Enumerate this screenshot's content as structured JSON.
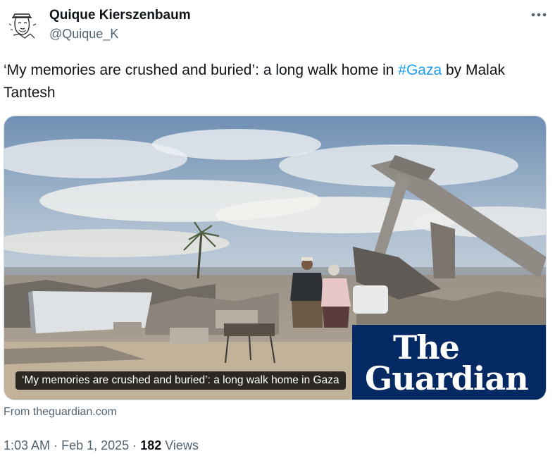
{
  "author": {
    "name": "Quique Kierszenbaum",
    "handle": "@Quique_K"
  },
  "tweet": {
    "text_before": "‘My memories are crushed and buried’: a long walk home in ",
    "hashtag": "#Gaza",
    "text_after": " by Malak Tantesh"
  },
  "card": {
    "caption": "‘My memories are crushed and buried’: a long walk home in Gaza",
    "logo_line1": "The",
    "logo_line2": "Guardian",
    "source": "From theguardian.com"
  },
  "meta": {
    "time": "1:03 AM",
    "separator": "·",
    "date": "Feb 1, 2025",
    "views_count": "182",
    "views_label": "Views"
  },
  "icons": {
    "more": "more-horizontal-icon",
    "avatar": "sketch-avatar"
  },
  "colors": {
    "link": "#1d9bf0",
    "secondary_text": "#536471",
    "guardian_blue": "#052962"
  }
}
